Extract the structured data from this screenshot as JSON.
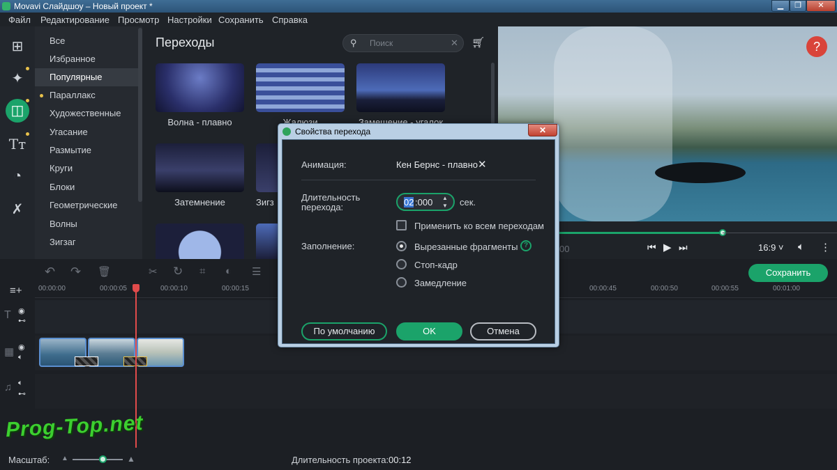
{
  "window": {
    "title": "Movavi Слайдшоу – Новый проект *"
  },
  "menu": [
    "Файл",
    "Редактирование",
    "Просмотр",
    "Настройки",
    "Сохранить",
    "Справка"
  ],
  "categories": {
    "items": [
      "Все",
      "Избранное",
      "Популярные",
      "Параллакс",
      "Художественные",
      "Угасание",
      "Размытие",
      "Круги",
      "Блоки",
      "Геометрические",
      "Волны",
      "Зигзаг"
    ],
    "selected": "Популярные"
  },
  "transitions": {
    "title": "Переходы",
    "search_placeholder": "Поиск",
    "items": [
      "Волна - плавно",
      "Жалюзи",
      "Замещение - угалок",
      "Затемнение",
      "Зигз"
    ]
  },
  "preview": {
    "aspect": "16:9 ˅",
    "time_fragment": "00",
    "help": "?"
  },
  "timeline": {
    "ruler": [
      "00:00:00",
      "00:00:05",
      "00:00:10",
      "00:00:15",
      "00:00:45",
      "00:00:50",
      "00:00:55",
      "00:01:00"
    ],
    "save_label": "Сохранить",
    "zoom_label": "Масштаб:",
    "duration_label": "Длительность проекта:",
    "duration_value": "00:12"
  },
  "dialog": {
    "title": "Свойства перехода",
    "animation_label": "Анимация:",
    "animation_value": "Кен Бернс - плавно",
    "duration_label": "Длительность перехода:",
    "duration_sel": "02",
    "duration_rest": ":000",
    "duration_unit": "сек.",
    "apply_all": "Применить ко всем переходам",
    "fill_label": "Заполнение:",
    "fill_options": [
      "Вырезанные фрагменты",
      "Стоп-кадр",
      "Замедление"
    ],
    "fill_selected": "Вырезанные фрагменты",
    "btn_default": "По умолчанию",
    "btn_ok": "OK",
    "btn_cancel": "Отмена"
  },
  "watermark": "Prog-Top.net",
  "colors": {
    "accent": "#1ba36a",
    "playhead": "#e14b4b",
    "dot": "#e8c14b"
  }
}
